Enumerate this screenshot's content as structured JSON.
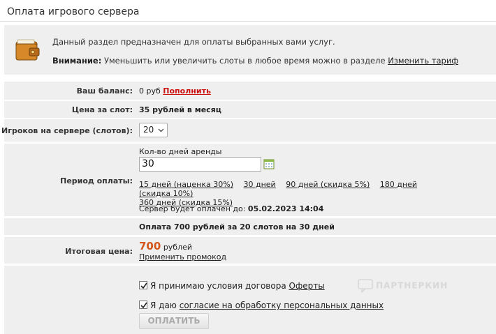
{
  "page": {
    "title": "Оплата игрового сервера"
  },
  "info": {
    "line1": "Данный раздел предназначен для оплаты выбранных вами услуг.",
    "attention_label": "Внимание:",
    "attention_text": "Уменьшить или увеличить слоты в любое время можно в разделе",
    "change_tariff_link": "Изменить тариф"
  },
  "balance": {
    "label": "Ваш баланс:",
    "value": "0 руб",
    "topup_link": "Пополнить"
  },
  "slot_price": {
    "label": "Цена за слот:",
    "value": "35 рублей в месяц"
  },
  "players": {
    "label": "Игроков на сервере (слотов):",
    "selected": "20"
  },
  "period": {
    "label": "Период оплаты:",
    "days_caption": "Кол-во дней аренды",
    "days_value": "30",
    "options": [
      "15 дней (наценка 30%)",
      "30 дней",
      "90 дней (скидка 5%)",
      "180 дней (скидка 10%)",
      "360 дней (скидка 15%)"
    ],
    "paid_until_label": "Сервер будет оплачен до:",
    "paid_until_value": "05.02.2023 14:04"
  },
  "summary": {
    "text": "Оплата 700 рублей за 20 слотов на 30 дней"
  },
  "total": {
    "label": "Итоговая цена:",
    "amount": "700",
    "currency": "рублей",
    "promo_link": "Применить промокод"
  },
  "agreements": {
    "offer_text": "Я принимаю условия договора",
    "offer_link": "Оферты",
    "consent_text": "Я даю",
    "consent_link": "согласие на обработку персональных данных"
  },
  "pay_button": "ОПЛАТИТЬ",
  "watermark": "ПАРТНЕРКИН",
  "colors": {
    "panel_bg": "#efefef",
    "accent_red": "#cc1111",
    "price_orange": "#d2561a"
  }
}
